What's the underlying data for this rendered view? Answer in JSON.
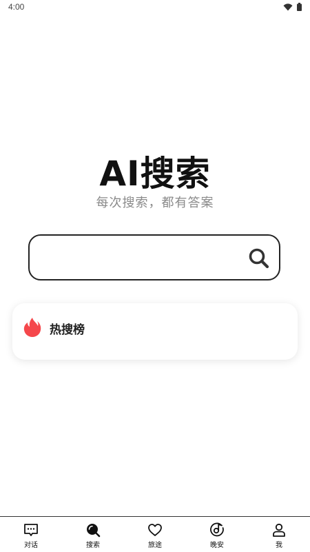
{
  "status_bar": {
    "time": "4:00",
    "wifi_icon": "wifi-icon",
    "battery_icon": "battery-icon"
  },
  "hero": {
    "title": "AI搜索",
    "subtitle": "每次搜索，都有答案"
  },
  "search": {
    "value": "",
    "placeholder": "",
    "button_icon": "search-icon"
  },
  "hot": {
    "icon": "flame-icon",
    "title": "热搜榜",
    "accent": "#f5474b"
  },
  "tabs": [
    {
      "label": "对话",
      "icon": "chat-icon",
      "active": false
    },
    {
      "label": "搜索",
      "icon": "search-icon",
      "active": true
    },
    {
      "label": "旅途",
      "icon": "heart-icon",
      "active": false
    },
    {
      "label": "晚安",
      "icon": "music-disc-icon",
      "active": false
    },
    {
      "label": "我",
      "icon": "user-icon",
      "active": false
    }
  ]
}
